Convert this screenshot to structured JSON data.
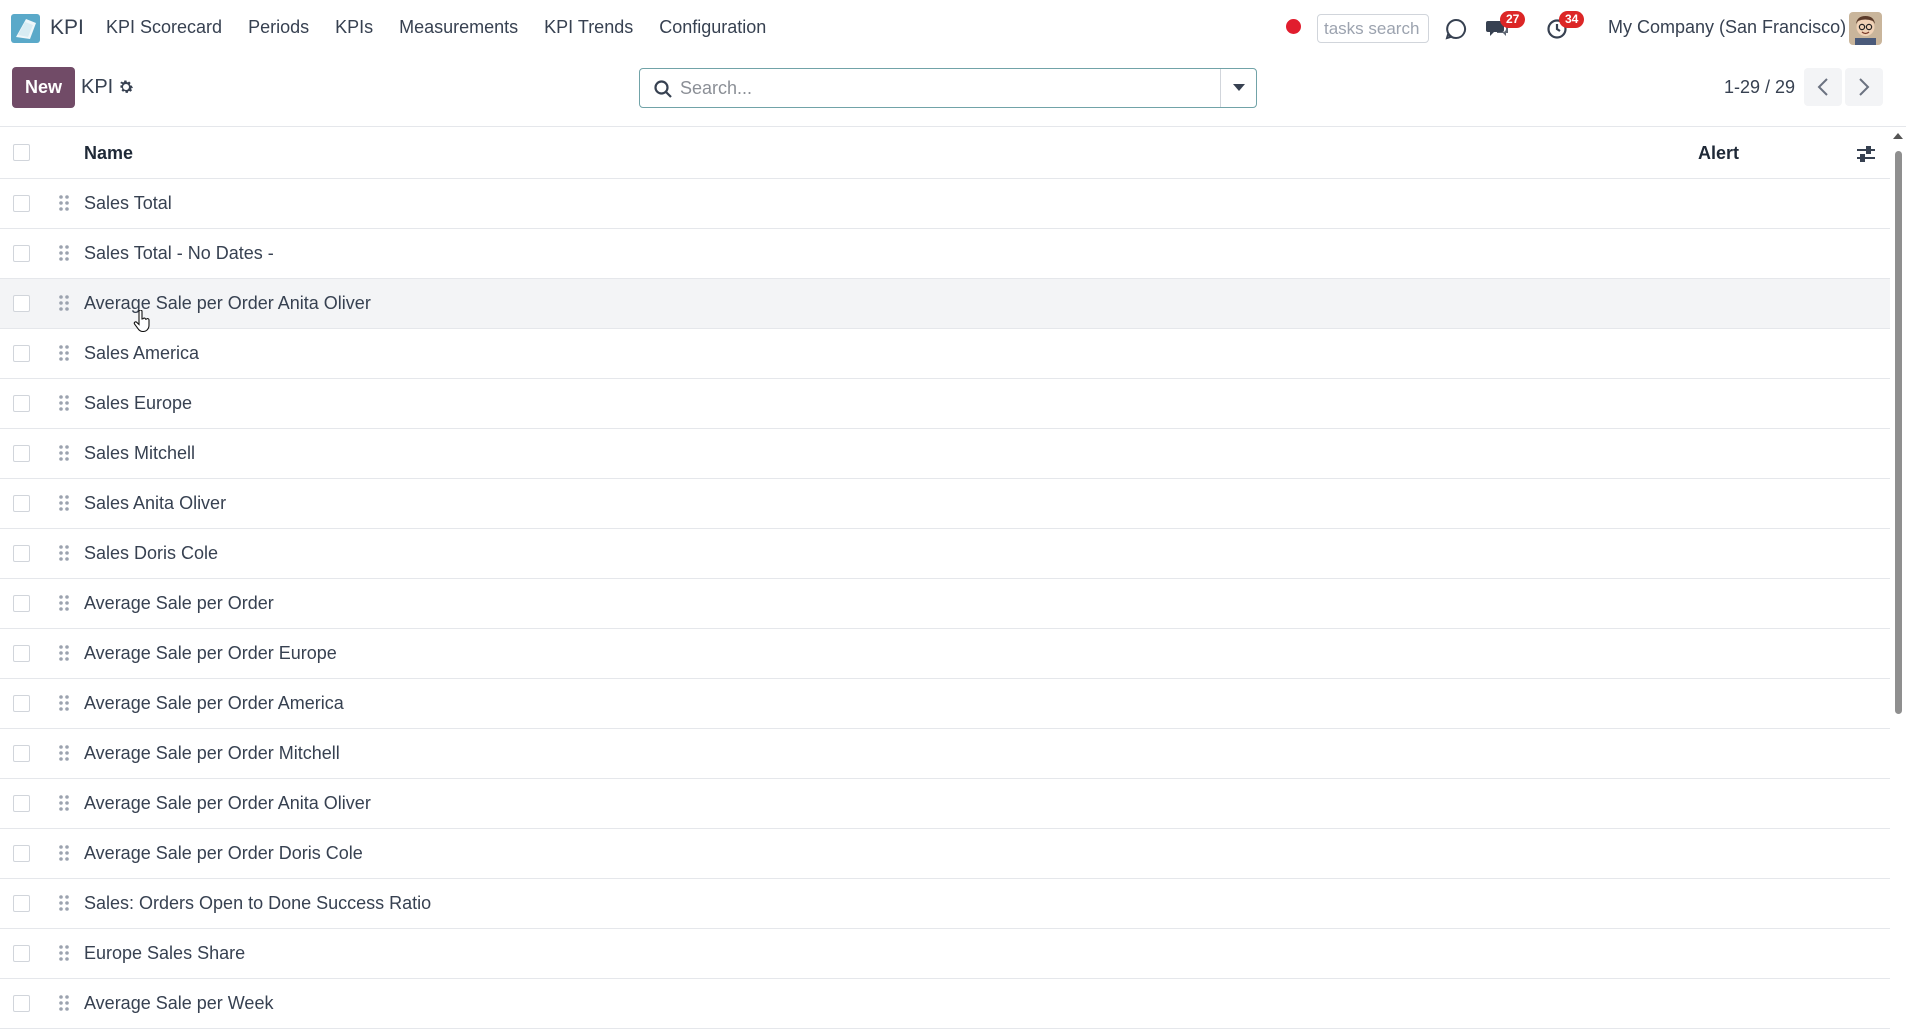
{
  "navbar": {
    "app_name": "KPI",
    "menu": [
      {
        "label": "KPI Scorecard"
      },
      {
        "label": "Periods"
      },
      {
        "label": "KPIs"
      },
      {
        "label": "Measurements"
      },
      {
        "label": "KPI Trends"
      },
      {
        "label": "Configuration"
      }
    ],
    "tasks_search_placeholder": "tasks search",
    "messages_count": "27",
    "activities_count": "34",
    "company": "My Company (San Francisco)",
    "icons": [
      "app-logo-icon",
      "record-icon",
      "chat-icon",
      "messages-icon",
      "activity-clock-icon",
      "avatar"
    ],
    "colors": {
      "brand": "#714b67",
      "record": "#e11d2e",
      "badge": "#dc2626"
    }
  },
  "control_panel": {
    "new_label": "New",
    "breadcrumb": "KPI",
    "search_placeholder": "Search...",
    "pager_value": "1-29 / 29"
  },
  "list": {
    "columns": {
      "name": "Name",
      "alert": "Alert"
    },
    "rows": [
      {
        "name": "Sales Total"
      },
      {
        "name": "Sales Total - No Dates -"
      },
      {
        "name": "Average Sale per Order Anita Oliver"
      },
      {
        "name": "Sales America"
      },
      {
        "name": "Sales Europe"
      },
      {
        "name": "Sales Mitchell"
      },
      {
        "name": "Sales Anita Oliver"
      },
      {
        "name": "Sales Doris Cole"
      },
      {
        "name": "Average Sale per Order"
      },
      {
        "name": "Average Sale per Order Europe"
      },
      {
        "name": "Average Sale per Order America"
      },
      {
        "name": "Average Sale per Order Mitchell"
      },
      {
        "name": "Average Sale per Order Anita Oliver"
      },
      {
        "name": "Average Sale per Order Doris Cole"
      },
      {
        "name": "Sales: Orders Open to Done Success Ratio"
      },
      {
        "name": "Europe Sales Share"
      },
      {
        "name": "Average Sale per Week"
      }
    ]
  }
}
